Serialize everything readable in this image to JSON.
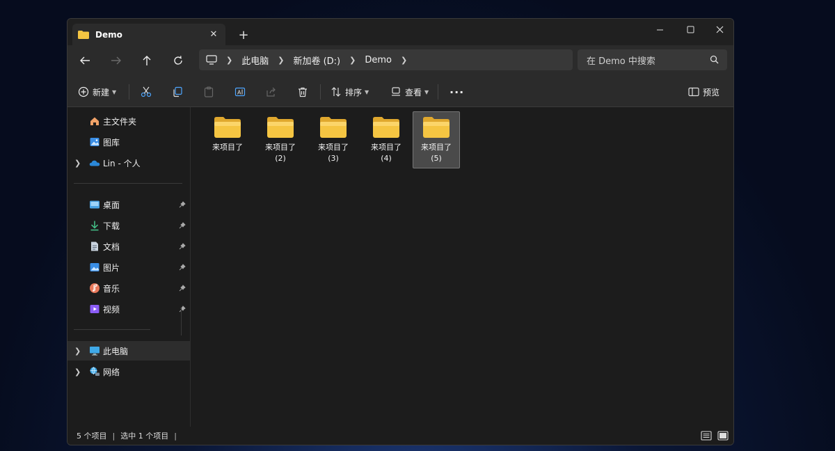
{
  "window": {
    "tab_title": "Demo",
    "tab_close": "✕",
    "new_tab": "+",
    "minimize": "—",
    "maximize": "☐",
    "close": "✕"
  },
  "address": {
    "breadcrumbs": [
      "此电脑",
      "新加卷 (D:)",
      "Demo"
    ],
    "search_placeholder": "在 Demo 中搜索"
  },
  "commands": {
    "new_label": "新建",
    "sort_label": "排序",
    "view_label": "查看",
    "more_label": "···",
    "preview_label": "预览"
  },
  "nav": {
    "home": "主文件夹",
    "gallery": "图库",
    "onedrive": "Lin - 个人",
    "desktop": "桌面",
    "downloads": "下载",
    "documents": "文档",
    "pictures": "图片",
    "music": "音乐",
    "videos": "视频",
    "this_pc": "此电脑",
    "network": "网络"
  },
  "folders": [
    {
      "line1": "来项目了",
      "line2": ""
    },
    {
      "line1": "来项目了",
      "line2": "(2)"
    },
    {
      "line1": "来项目了",
      "line2": "(3)"
    },
    {
      "line1": "来项目了",
      "line2": "(4)"
    },
    {
      "line1": "来项目了",
      "line2": "(5)"
    }
  ],
  "status": {
    "item_count": "5 个项目",
    "selected": "选中 1 个项目",
    "trailing_sep": "|"
  },
  "colors": {
    "folder": "#f5c542",
    "accent": "#4ea6ff"
  }
}
